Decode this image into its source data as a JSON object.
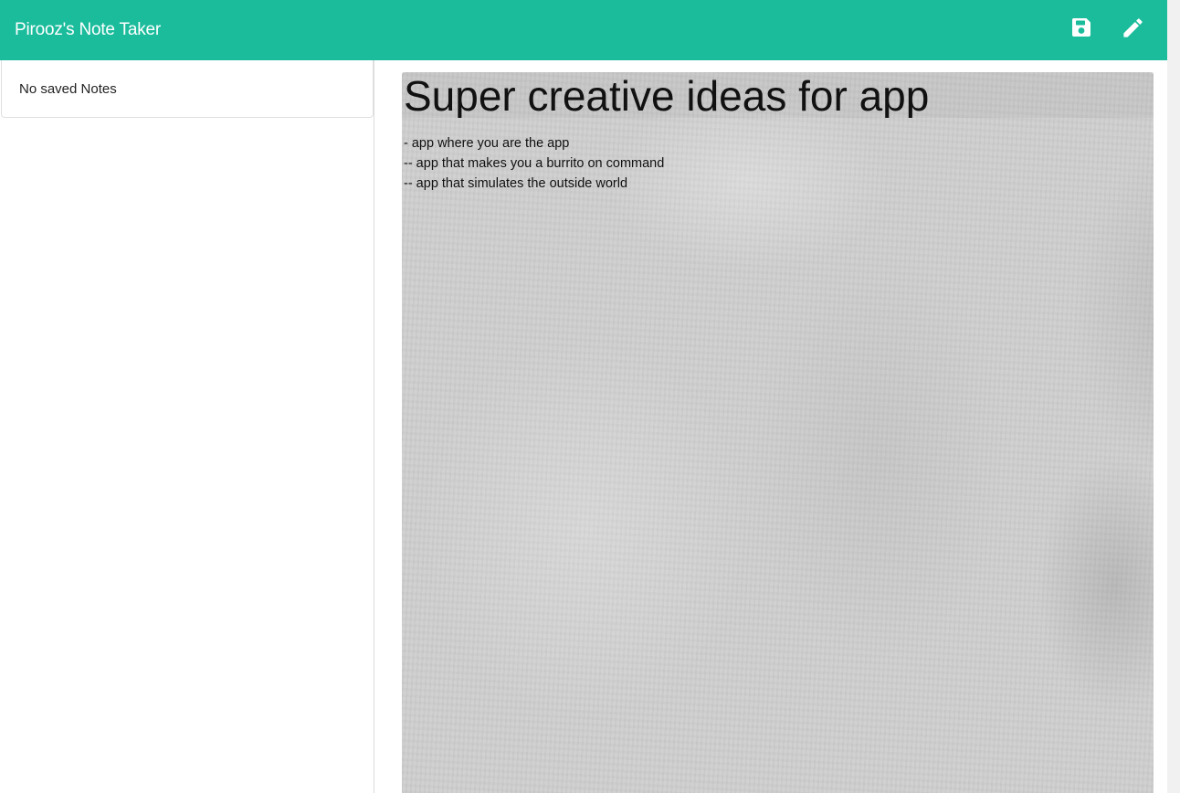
{
  "navbar": {
    "brand": "Pirooz's Note Taker",
    "accent_color": "#1abc9c",
    "icons": [
      {
        "name": "save-icon",
        "label": "Save Note"
      },
      {
        "name": "pencil-icon",
        "label": "New Note"
      }
    ]
  },
  "sidebar": {
    "items": [
      {
        "label": "No saved Notes"
      }
    ]
  },
  "editor": {
    "title": "Super creative ideas for app",
    "body_lines": [
      "- app where you are the app",
      "-- app that makes you a burrito on command",
      "-- app that simulates the outside world"
    ]
  }
}
